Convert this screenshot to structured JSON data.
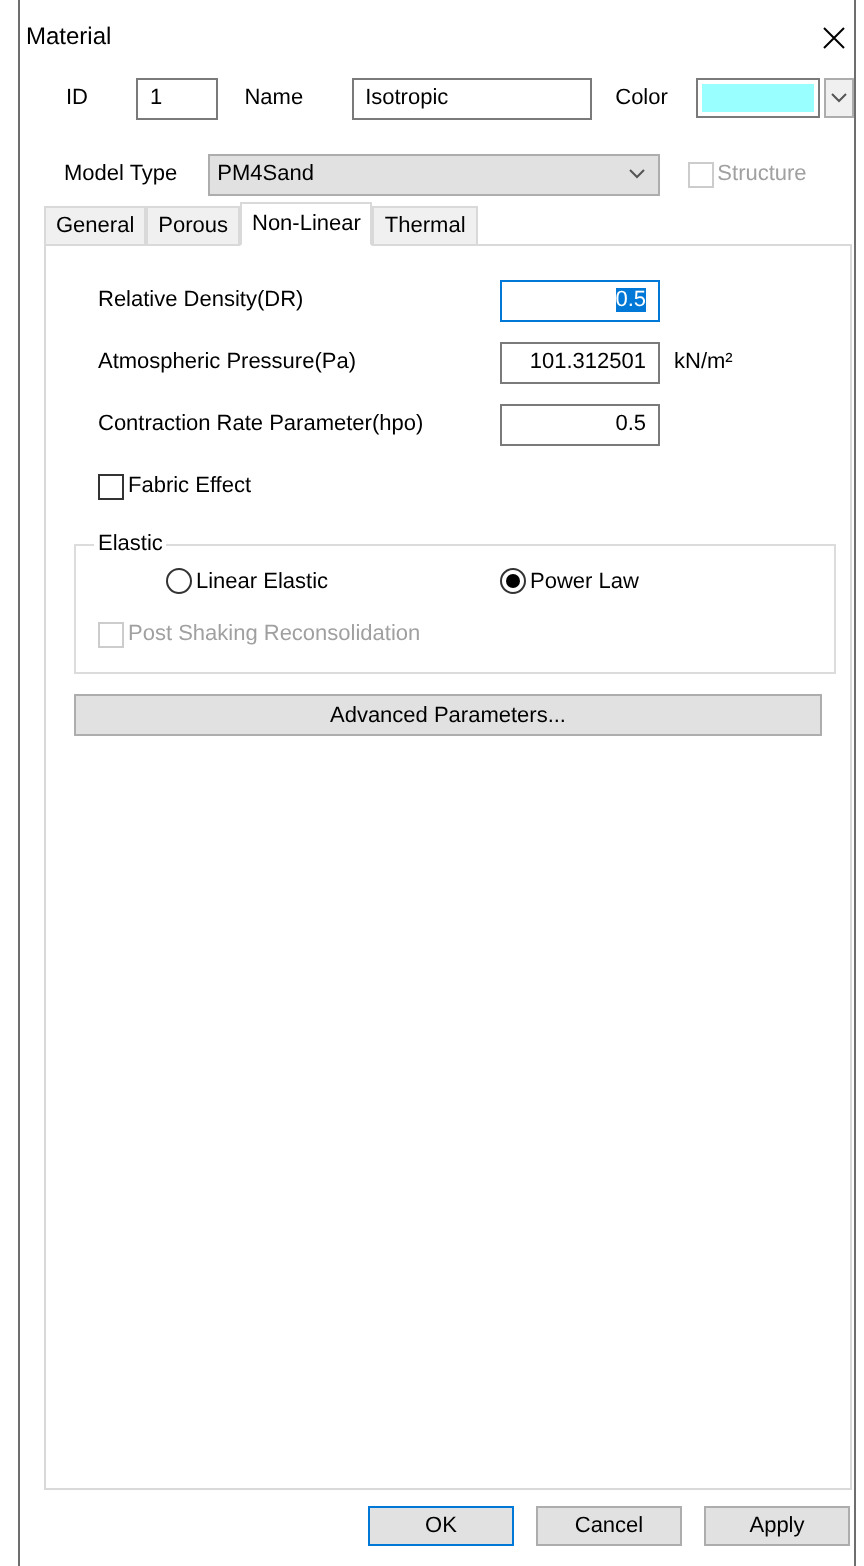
{
  "window": {
    "title": "Material"
  },
  "id": {
    "label": "ID",
    "value": "1"
  },
  "name": {
    "label": "Name",
    "value": "Isotropic"
  },
  "color": {
    "label": "Color",
    "color": "#99ffff"
  },
  "model_type": {
    "label": "Model Type",
    "value": "PM4Sand"
  },
  "structure": {
    "label": "Structure",
    "checked": false,
    "disabled": true
  },
  "tabs": [
    {
      "label": "General",
      "selected": false
    },
    {
      "label": "Porous",
      "selected": false
    },
    {
      "label": "Non-Linear",
      "selected": true
    },
    {
      "label": "Thermal",
      "selected": false
    }
  ],
  "parameters": [
    {
      "label": "Relative Density(DR)",
      "value": "0.5",
      "focused": true
    },
    {
      "label": "Atmospheric Pressure(Pa)",
      "value": "101.312501",
      "unit": "kN/m²",
      "focused": false
    },
    {
      "label": "Contraction Rate Parameter(hpo)",
      "value": "0.5",
      "focused": false
    }
  ],
  "fabric_effect": {
    "label": "Fabric Effect",
    "checked": false
  },
  "elastic": {
    "title": "Elastic",
    "options": [
      {
        "label": "Linear Elastic",
        "selected": false
      },
      {
        "label": "Power Law",
        "selected": true
      }
    ],
    "post_shaking": {
      "label": "Post Shaking Reconsolidation",
      "checked": false,
      "disabled": true
    }
  },
  "advanced_button": {
    "label": "Advanced Parameters..."
  },
  "buttons": [
    {
      "label": "OK",
      "default": true
    },
    {
      "label": "Cancel",
      "default": false
    },
    {
      "label": "Apply",
      "default": false
    }
  ]
}
